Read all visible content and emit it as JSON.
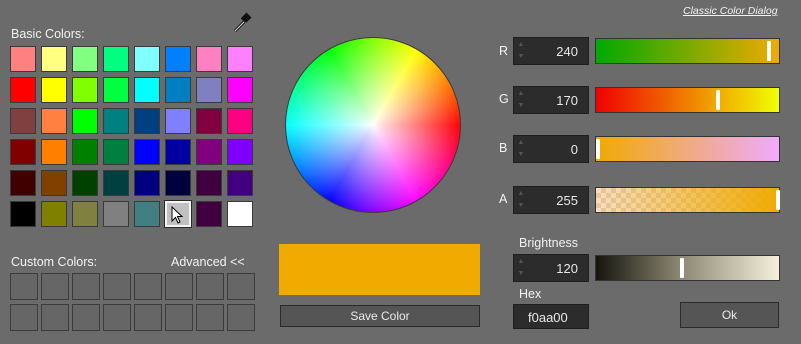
{
  "header": {
    "classic_link": "Classic Color Dialog"
  },
  "basic": {
    "title": "Basic Colors:",
    "colors": [
      [
        "#ff8080",
        "#ffff80",
        "#80ff80",
        "#00ff80",
        "#80ffff",
        "#0080ff",
        "#ff80c0",
        "#ff80ff"
      ],
      [
        "#ff0000",
        "#ffff00",
        "#80ff00",
        "#00ff40",
        "#00ffff",
        "#0080c0",
        "#8080c0",
        "#ff00ff"
      ],
      [
        "#804040",
        "#ff8040",
        "#00ff00",
        "#008080",
        "#004080",
        "#8080ff",
        "#800040",
        "#ff0080"
      ],
      [
        "#800000",
        "#ff8000",
        "#008000",
        "#008040",
        "#0000ff",
        "#0000a0",
        "#800080",
        "#8000ff"
      ],
      [
        "#400000",
        "#804000",
        "#004000",
        "#004040",
        "#000080",
        "#000040",
        "#400040",
        "#400080"
      ],
      [
        "#000000",
        "#808000",
        "#808040",
        "#808080",
        "#408080",
        "#c0c0c0",
        "#400040",
        "#ffffff"
      ]
    ]
  },
  "custom": {
    "title": "Custom Colors:",
    "advanced_label": "Advanced <<"
  },
  "preview": {
    "color": "#f0aa00"
  },
  "save_label": "Save Color",
  "channels": {
    "r": {
      "label": "R",
      "value": "240"
    },
    "g": {
      "label": "G",
      "value": "170"
    },
    "b": {
      "label": "B",
      "value": "0"
    },
    "a": {
      "label": "A",
      "value": "255"
    }
  },
  "brightness": {
    "label": "Brightness",
    "value": "120"
  },
  "hex": {
    "label": "Hex",
    "value": "f0aa00"
  },
  "ok_label": "Ok",
  "icons": {
    "eyedropper": "eyedropper-icon",
    "cursor": "cursor-icon"
  }
}
